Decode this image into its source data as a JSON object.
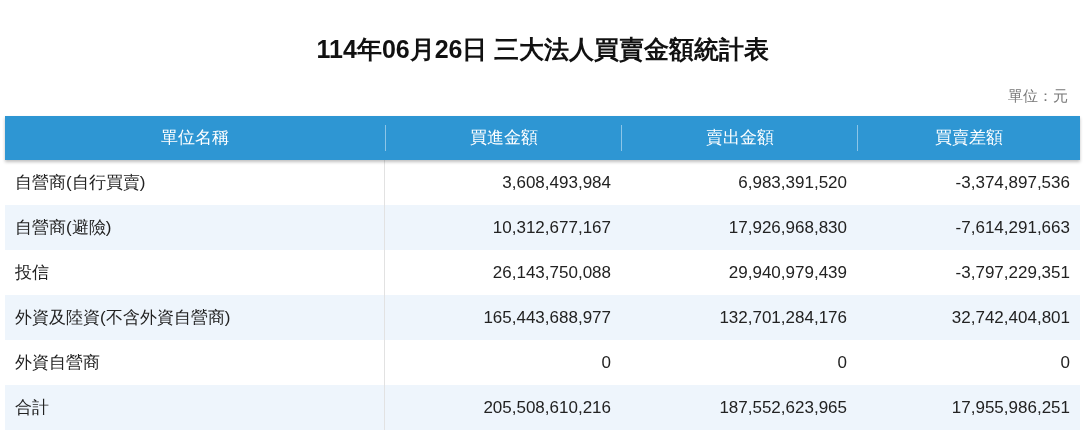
{
  "title": "114年06月26日 三大法人買賣金額統計表",
  "unit": "單位：元",
  "table": {
    "columns": [
      "單位名稱",
      "買進金額",
      "賣出金額",
      "買賣差額"
    ],
    "rows": [
      [
        "自營商(自行買賣)",
        "3,608,493,984",
        "6,983,391,520",
        "-3,374,897,536"
      ],
      [
        "自營商(避險)",
        "10,312,677,167",
        "17,926,968,830",
        "-7,614,291,663"
      ],
      [
        "投信",
        "26,143,750,088",
        "29,940,979,439",
        "-3,797,229,351"
      ],
      [
        "外資及陸資(不含外資自營商)",
        "165,443,688,977",
        "132,701,284,176",
        "32,742,404,801"
      ],
      [
        "外資自營商",
        "0",
        "0",
        "0"
      ],
      [
        "合計",
        "205,508,610,216",
        "187,552,623,965",
        "17,955,986,251"
      ]
    ]
  }
}
